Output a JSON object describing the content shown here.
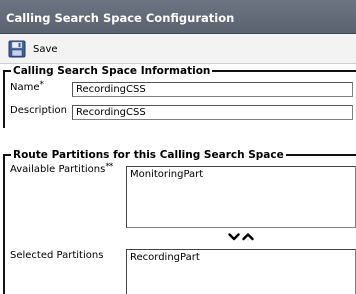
{
  "window": {
    "title": "Calling Search Space Configuration"
  },
  "toolbar": {
    "save_label": "Save",
    "save_icon": "floppy-disk-icon"
  },
  "info_section": {
    "legend": "Calling Search Space Information",
    "name_label": "Name",
    "name_required_marker": "*",
    "name_value": "RecordingCSS",
    "description_label": "Description",
    "description_value": "RecordingCSS"
  },
  "partitions_section": {
    "legend": "Route Partitions for this Calling Search Space",
    "available_label": "Available Partitions",
    "available_marker": "**",
    "available_items": [
      "MonitoringPart"
    ],
    "selected_label": "Selected Partitions",
    "selected_items": [
      "RecordingPart"
    ],
    "move_down_icon": "chevron-down-icon",
    "move_up_icon": "chevron-up-icon"
  },
  "colors": {
    "titlebar": "#626b77",
    "toolbar": "#f3f3f3",
    "border": "#111111"
  }
}
